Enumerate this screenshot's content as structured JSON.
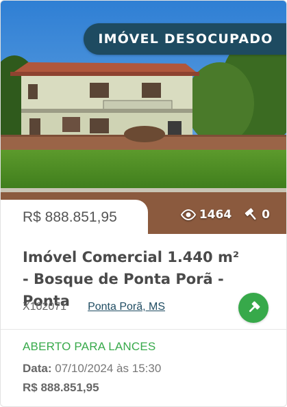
{
  "badge": {
    "label": "IMÓVEL DESOCUPADO"
  },
  "listing": {
    "price": "R$ 888.851,95",
    "views": "1464",
    "bids": "0",
    "title": "Imóvel Comercial 1.440 m² - Bosque de Ponta Porã - Ponta",
    "code": "X102071",
    "location": "Ponta Porã, MS",
    "status": "ABERTO PARA LANCES",
    "date_label": "Data:",
    "date_value": "07/10/2024 às 15:30",
    "current_bid": "R$ 888.851,95"
  },
  "icons": {
    "views": "eye-icon",
    "bids": "gavel-icon",
    "bid_button": "gavel-icon"
  },
  "colors": {
    "badge_bg": "#1e4b61",
    "status_green": "#37a94a",
    "link": "#1e4b61"
  }
}
